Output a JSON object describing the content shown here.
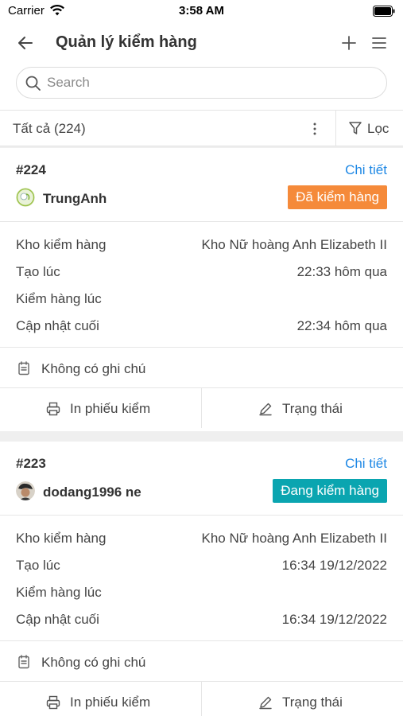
{
  "status_bar": {
    "carrier": "Carrier",
    "time": "3:58 AM"
  },
  "header": {
    "title": "Quản lý kiểm hàng"
  },
  "search": {
    "placeholder": "Search"
  },
  "filter_bar": {
    "all_label": "Tất cả (224)",
    "filter_label": "Lọc"
  },
  "cards": [
    {
      "id": "#224",
      "detail_link": "Chi tiết",
      "user": "TrungAnh",
      "status": "Đã kiểm hàng",
      "status_color": "#f58a3a",
      "rows": [
        {
          "label": "Kho kiểm hàng",
          "value": "Kho Nữ hoàng Anh Elizabeth II"
        },
        {
          "label": "Tạo lúc",
          "value": "22:33 hôm qua"
        },
        {
          "label": "Kiểm hàng lúc",
          "value": ""
        },
        {
          "label": "Cập nhật cuối",
          "value": "22:34 hôm qua"
        }
      ],
      "note": "Không có ghi chú",
      "print_label": "In phiếu kiểm",
      "status_action_label": "Trạng thái"
    },
    {
      "id": "#223",
      "detail_link": "Chi tiết",
      "user": "dodang1996 ne",
      "status": "Đang kiểm hàng",
      "status_color": "#0aa5b0",
      "rows": [
        {
          "label": "Kho kiểm hàng",
          "value": "Kho Nữ hoàng Anh Elizabeth II"
        },
        {
          "label": "Tạo lúc",
          "value": "16:34 19/12/2022"
        },
        {
          "label": "Kiểm hàng lúc",
          "value": ""
        },
        {
          "label": "Cập nhật cuối",
          "value": "16:34 19/12/2022"
        }
      ],
      "note": "Không có ghi chú",
      "print_label": "In phiếu kiểm",
      "status_action_label": "Trạng thái"
    }
  ]
}
